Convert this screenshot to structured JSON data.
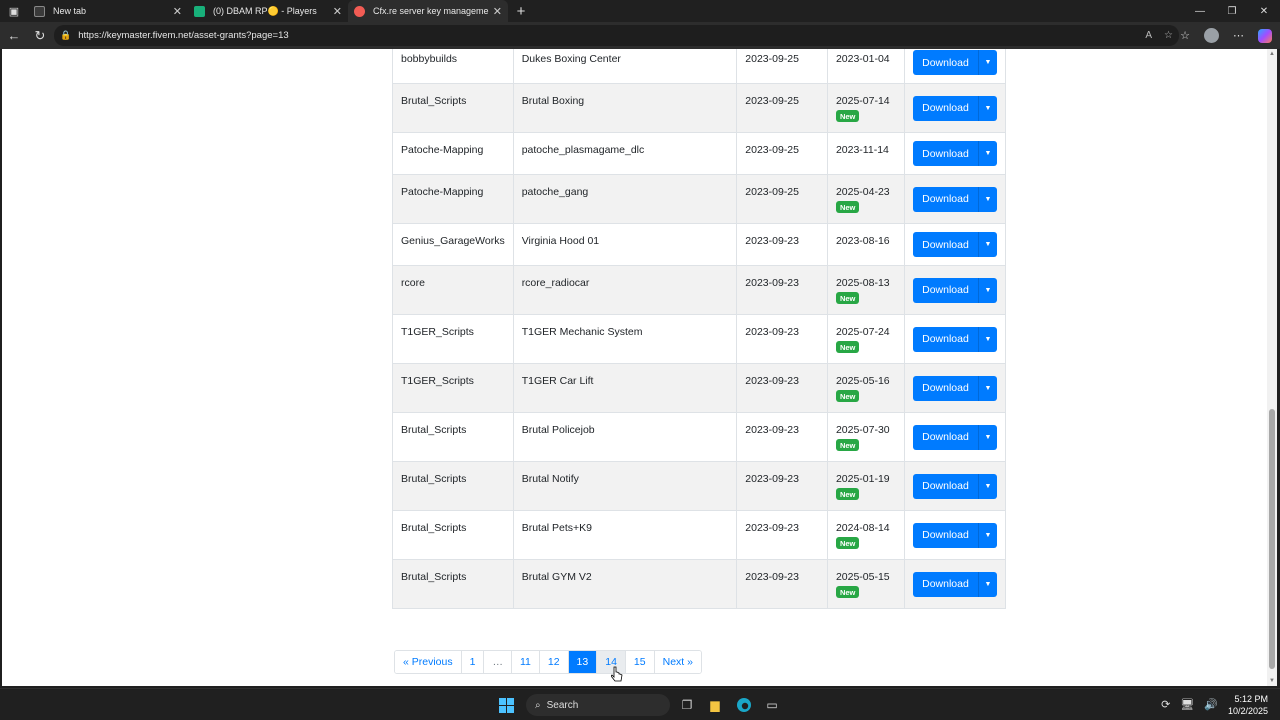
{
  "browser": {
    "tabs": [
      {
        "title": "New tab",
        "favicon_color": "#3a3a3a"
      },
      {
        "title": "(0) DBAM RP🟡 - Players",
        "favicon_color": "#18b07a"
      },
      {
        "title": "Cfx.re server key management",
        "favicon_color": "#f25c54"
      }
    ],
    "url": "https://keymaster.fivem.net/asset-grants?page=13"
  },
  "table": {
    "download_label": "Download",
    "new_label": "New",
    "rows": [
      {
        "author": "bobbybuilds",
        "asset": "Dukes Boxing Center",
        "granted": "2023-09-25",
        "updated": "2023-01-04",
        "is_new": false
      },
      {
        "author": "Brutal_Scripts",
        "asset": "Brutal Boxing",
        "granted": "2023-09-25",
        "updated": "2025-07-14",
        "is_new": true
      },
      {
        "author": "Patoche-Mapping",
        "asset": "patoche_plasmagame_dlc",
        "granted": "2023-09-25",
        "updated": "2023-11-14",
        "is_new": false
      },
      {
        "author": "Patoche-Mapping",
        "asset": "patoche_gang",
        "granted": "2023-09-25",
        "updated": "2025-04-23",
        "is_new": true
      },
      {
        "author": "Genius_GarageWorks",
        "asset": "Virginia Hood 01",
        "granted": "2023-09-23",
        "updated": "2023-08-16",
        "is_new": false
      },
      {
        "author": "rcore",
        "asset": "rcore_radiocar",
        "granted": "2023-09-23",
        "updated": "2025-08-13",
        "is_new": true
      },
      {
        "author": "T1GER_Scripts",
        "asset": "T1GER Mechanic System",
        "granted": "2023-09-23",
        "updated": "2025-07-24",
        "is_new": true
      },
      {
        "author": "T1GER_Scripts",
        "asset": "T1GER Car Lift",
        "granted": "2023-09-23",
        "updated": "2025-05-16",
        "is_new": true
      },
      {
        "author": "Brutal_Scripts",
        "asset": "Brutal Policejob",
        "granted": "2023-09-23",
        "updated": "2025-07-30",
        "is_new": true
      },
      {
        "author": "Brutal_Scripts",
        "asset": "Brutal Notify",
        "granted": "2023-09-23",
        "updated": "2025-01-19",
        "is_new": true
      },
      {
        "author": "Brutal_Scripts",
        "asset": "Brutal Pets+K9",
        "granted": "2023-09-23",
        "updated": "2024-08-14",
        "is_new": true
      },
      {
        "author": "Brutal_Scripts",
        "asset": "Brutal GYM V2",
        "granted": "2023-09-23",
        "updated": "2025-05-15",
        "is_new": true
      }
    ]
  },
  "pagination": {
    "items": [
      {
        "label": "« Previous",
        "state": "link"
      },
      {
        "label": "1",
        "state": "link"
      },
      {
        "label": "…",
        "state": "ellipsis"
      },
      {
        "label": "11",
        "state": "link"
      },
      {
        "label": "12",
        "state": "link"
      },
      {
        "label": "13",
        "state": "current"
      },
      {
        "label": "14",
        "state": "hover"
      },
      {
        "label": "15",
        "state": "link"
      },
      {
        "label": "Next »",
        "state": "link"
      }
    ]
  },
  "taskbar": {
    "search_label": "Search",
    "time": "5:12 PM",
    "date": "10/2/2025"
  },
  "colors": {
    "primary": "#007bff",
    "new_badge": "#28a745"
  },
  "icons": [
    "tab-actions-icon",
    "close-icon",
    "new-tab-icon",
    "minimize-icon",
    "restore-icon",
    "back-icon",
    "refresh-icon",
    "site-info-icon",
    "read-aloud-icon",
    "favorite-star-icon",
    "favorites-icon",
    "profile-icon",
    "more-icon",
    "copilot-icon",
    "caret-down-icon",
    "windows-start-icon",
    "search-icon",
    "task-view-icon",
    "file-explorer-icon",
    "edge-icon",
    "terminal-icon",
    "network-icon",
    "volume-icon",
    "sync-icon",
    "mouse-cursor-icon"
  ]
}
